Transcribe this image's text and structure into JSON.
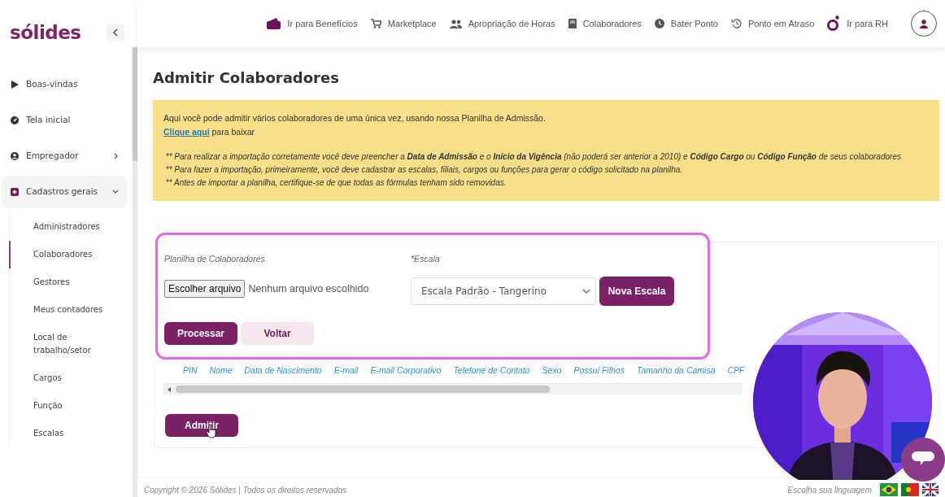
{
  "logo": "sólides",
  "sidebar": {
    "items": [
      {
        "label": "Boas-vindas"
      },
      {
        "label": "Tela inicial"
      },
      {
        "label": "Empregador",
        "expanded": false
      },
      {
        "label": "Cadastros gerais",
        "expanded": true,
        "children": [
          {
            "label": "Administradores",
            "selected": false
          },
          {
            "label": "Colaboradores",
            "selected": true
          },
          {
            "label": "Gestores",
            "selected": false
          },
          {
            "label": "Meus contadores",
            "selected": false
          },
          {
            "label": "Local de trabalho/setor",
            "selected": false
          },
          {
            "label": "Cargos",
            "selected": false
          },
          {
            "label": "Função",
            "selected": false
          },
          {
            "label": "Escalas",
            "selected": false
          }
        ]
      }
    ]
  },
  "top_nav": [
    {
      "label": "Ir para Benefícios"
    },
    {
      "label": "Marketplace"
    },
    {
      "label": "Apropriação de Horas"
    },
    {
      "label": "Colaboradores"
    },
    {
      "label": "Bater Ponto"
    },
    {
      "label": "Ponto em Atraso"
    },
    {
      "label": "Ir para RH"
    }
  ],
  "page_title": "Admitir Colaboradores",
  "notice": {
    "intro": "Aqui você pode admitir vários colaboradores de uma única vez, usando nossa Planilha de Admissão.",
    "link": "Clique aqui",
    "link_suffix": "para baixar",
    "notes": [
      {
        "prefix": "**",
        "text": "Para realizar a importação corretamente você deve preencher a **Data de Admissão** e o **Início da Vigência** (não poderá ser anterior a 2010) e **Código Cargo** ou **Código Função** de seus colaboradores"
      },
      {
        "prefix": "**",
        "text": "Para fazer a importação, primeiramente, você deve cadastrar as escalas, filiais, cargos ou funções para gerar o código solicitado na planilha."
      },
      {
        "prefix": "**",
        "text": "Antes de importar a planilha, certifique-se de que todas as fórmulas tenham sido removidas."
      }
    ]
  },
  "form": {
    "file_label": "Planilha de Colaboradores",
    "file_button": "Escolher arquivo",
    "file_status": "Nenhum arquivo escolhido",
    "scale_label": "*Escala",
    "scale_value": "Escala Padrão - Tangerino",
    "new_scale_button": "Nova Escala",
    "buttons": [
      {
        "label": "Processar",
        "kind": "primary"
      },
      {
        "label": "Voltar",
        "kind": "secondary"
      }
    ]
  },
  "table": {
    "columns": [
      "PIN",
      "Nome",
      "Data de Nascimento",
      "E-mail",
      "E-mail Corporativo",
      "Telefone de Contato",
      "Sexo",
      "Possui Filhos",
      "Tamanho da Camisa",
      "CPF"
    ]
  },
  "admit_button": "Admitir",
  "footer": {
    "copyright": "Copyright © 2026 Sólides | Todos os direitos reservados",
    "language_label": "Escolha sua linguagem"
  }
}
